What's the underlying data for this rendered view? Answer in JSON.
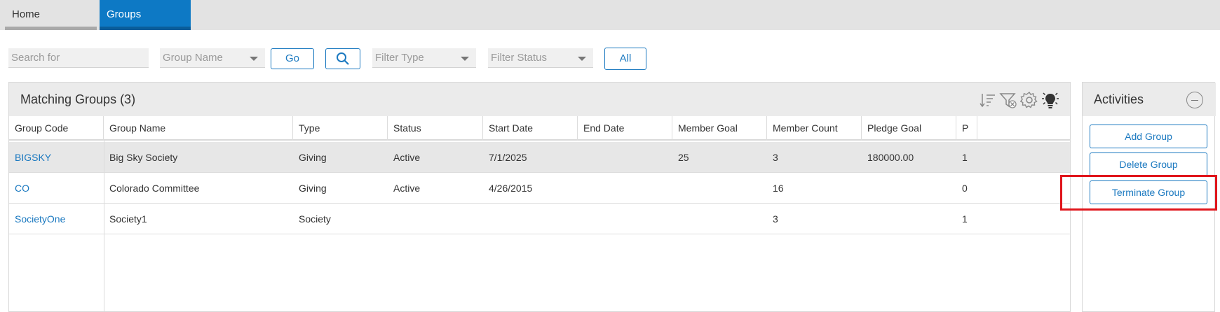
{
  "tabs": [
    {
      "label": "Home",
      "active": false
    },
    {
      "label": "Groups",
      "active": true
    }
  ],
  "search": {
    "search_placeholder": "Search for",
    "search_value": "",
    "field_select": "Group Name",
    "go_label": "Go",
    "filter_type": "Filter Type",
    "filter_status": "Filter Status",
    "all_label": "All"
  },
  "grid": {
    "title": "Matching Groups (3)",
    "toolbar_icons": [
      "sort-icon",
      "clear-filter-icon",
      "gear-icon",
      "lightbulb-icon"
    ],
    "columns": [
      "Group Code",
      "Group Name",
      "Type",
      "Status",
      "Start Date",
      "End Date",
      "Member Goal",
      "Member Count",
      "Pledge Goal",
      "P"
    ],
    "rows": [
      [
        "BIGSKY",
        "Big Sky Society",
        "Giving",
        "Active",
        "7/1/2025",
        "",
        "25",
        "3",
        "180000.00",
        "1"
      ],
      [
        "CO",
        "Colorado Committee",
        "Giving",
        "Active",
        "4/26/2015",
        "",
        "",
        "16",
        "",
        "0"
      ],
      [
        "SocietyOne",
        "Society1",
        "Society",
        "",
        "",
        "",
        "",
        "3",
        "",
        "1"
      ]
    ]
  },
  "activities": {
    "title": "Activities",
    "buttons": [
      "Add Group",
      "Delete Group",
      "Terminate Group"
    ]
  },
  "colors": {
    "accent": "#1b79c0",
    "active_tab": "#0d79c5",
    "highlight": "#e0151b"
  }
}
